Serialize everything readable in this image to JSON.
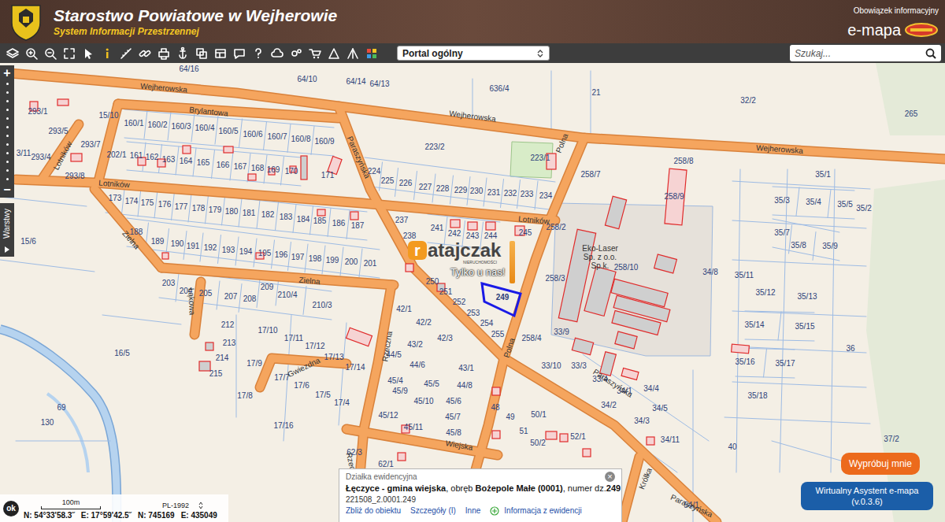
{
  "header": {
    "title": "Starostwo Powiatowe w Wejherowie",
    "subtitle": "System Informacji Przestrzennej",
    "info_link": "Obowiązek informacyjny",
    "brand": "e-mapa"
  },
  "toolbar": {
    "portal": {
      "value": "Portal ogólny"
    },
    "search": {
      "placeholder": "Szukaj..."
    }
  },
  "zoom_bar": {
    "zoom_in": "+",
    "zoom_out": "−"
  },
  "layers_tab": {
    "label": "Warstwy"
  },
  "map": {
    "streets": [
      "Wejherowska",
      "Wejherowska",
      "Wejherowska",
      "Brylantowa",
      "Paraszyńska",
      "Paraszyńska",
      "Paraszyńska",
      "Lotników",
      "Lotników",
      "Lotników",
      "Polna",
      "Polna",
      "Zielna",
      "Zielna",
      "Łąkowa",
      "Rzeczna",
      "Rzeczna",
      "Gwiezdna",
      "Wiejska",
      "Królka"
    ],
    "parcels": [
      {
        "label": "64/16",
        "selected": false
      },
      {
        "label": "64/10",
        "selected": false
      },
      {
        "label": "64/14",
        "selected": false
      },
      {
        "label": "64/13",
        "selected": false
      },
      {
        "label": "636/4",
        "selected": false
      },
      {
        "label": "21",
        "selected": false
      },
      {
        "label": "32/2",
        "selected": false
      },
      {
        "label": "265",
        "selected": false
      },
      {
        "label": "293/1",
        "selected": false
      },
      {
        "label": "15/10",
        "selected": false
      },
      {
        "label": "160/1",
        "selected": false
      },
      {
        "label": "160/2",
        "selected": false
      },
      {
        "label": "160/3",
        "selected": false
      },
      {
        "label": "160/4",
        "selected": false
      },
      {
        "label": "160/5",
        "selected": false
      },
      {
        "label": "160/6",
        "selected": false
      },
      {
        "label": "160/7",
        "selected": false
      },
      {
        "label": "160/8",
        "selected": false
      },
      {
        "label": "160/9",
        "selected": false
      },
      {
        "label": "293/5",
        "selected": false
      },
      {
        "label": "293/7",
        "selected": false
      },
      {
        "label": "3/11",
        "selected": false
      },
      {
        "label": "293/4",
        "selected": false
      },
      {
        "label": "202/1",
        "selected": false
      },
      {
        "label": "161",
        "selected": false
      },
      {
        "label": "162",
        "selected": false
      },
      {
        "label": "163",
        "selected": false
      },
      {
        "label": "164",
        "selected": false
      },
      {
        "label": "165",
        "selected": false
      },
      {
        "label": "166",
        "selected": false
      },
      {
        "label": "167",
        "selected": false
      },
      {
        "label": "168",
        "selected": false
      },
      {
        "label": "169",
        "selected": false
      },
      {
        "label": "170",
        "selected": false
      },
      {
        "label": "171",
        "selected": false
      },
      {
        "label": "293/8",
        "selected": false
      },
      {
        "label": "223/2",
        "selected": false
      },
      {
        "label": "223/1",
        "selected": false
      },
      {
        "label": "258/7",
        "selected": false
      },
      {
        "label": "258/8",
        "selected": false
      },
      {
        "label": "258/9",
        "selected": false
      },
      {
        "label": "224",
        "selected": false
      },
      {
        "label": "225",
        "selected": false
      },
      {
        "label": "226",
        "selected": false
      },
      {
        "label": "227",
        "selected": false
      },
      {
        "label": "228",
        "selected": false
      },
      {
        "label": "229",
        "selected": false
      },
      {
        "label": "230",
        "selected": false
      },
      {
        "label": "231",
        "selected": false
      },
      {
        "label": "232",
        "selected": false
      },
      {
        "label": "233",
        "selected": false
      },
      {
        "label": "234",
        "selected": false
      },
      {
        "label": "35/1",
        "selected": false
      },
      {
        "label": "173",
        "selected": false
      },
      {
        "label": "174",
        "selected": false
      },
      {
        "label": "175",
        "selected": false
      },
      {
        "label": "176",
        "selected": false
      },
      {
        "label": "177",
        "selected": false
      },
      {
        "label": "178",
        "selected": false
      },
      {
        "label": "179",
        "selected": false
      },
      {
        "label": "180",
        "selected": false
      },
      {
        "label": "181",
        "selected": false
      },
      {
        "label": "182",
        "selected": false
      },
      {
        "label": "183",
        "selected": false
      },
      {
        "label": "184",
        "selected": false
      },
      {
        "label": "185",
        "selected": false
      },
      {
        "label": "186",
        "selected": false
      },
      {
        "label": "187",
        "selected": false
      },
      {
        "label": "35/3",
        "selected": false
      },
      {
        "label": "35/4",
        "selected": false
      },
      {
        "label": "35/5",
        "selected": false
      },
      {
        "label": "35/2",
        "selected": false
      },
      {
        "label": "237",
        "selected": false
      },
      {
        "label": "241",
        "selected": false
      },
      {
        "label": "242",
        "selected": false
      },
      {
        "label": "243",
        "selected": false
      },
      {
        "label": "244",
        "selected": false
      },
      {
        "label": "245",
        "selected": false
      },
      {
        "label": "238",
        "selected": false
      },
      {
        "label": "188",
        "selected": false
      },
      {
        "label": "189",
        "selected": false
      },
      {
        "label": "190",
        "selected": false
      },
      {
        "label": "191",
        "selected": false
      },
      {
        "label": "192",
        "selected": false
      },
      {
        "label": "193",
        "selected": false
      },
      {
        "label": "194",
        "selected": false
      },
      {
        "label": "195",
        "selected": false
      },
      {
        "label": "196",
        "selected": false
      },
      {
        "label": "197",
        "selected": false
      },
      {
        "label": "198",
        "selected": false
      },
      {
        "label": "199",
        "selected": false
      },
      {
        "label": "200",
        "selected": false
      },
      {
        "label": "201",
        "selected": false
      },
      {
        "label": "15/6",
        "selected": false
      },
      {
        "label": "258/2",
        "selected": false
      },
      {
        "label": "35/7",
        "selected": false
      },
      {
        "label": "35/8",
        "selected": false
      },
      {
        "label": "35/9",
        "selected": false
      },
      {
        "label": "34/8",
        "selected": false
      },
      {
        "label": "35/11",
        "selected": false
      },
      {
        "label": "35/12",
        "selected": false
      },
      {
        "label": "35/13",
        "selected": false
      },
      {
        "label": "258/10",
        "selected": false
      },
      {
        "label": "258/3",
        "selected": false
      },
      {
        "label": "203",
        "selected": false
      },
      {
        "label": "204",
        "selected": false
      },
      {
        "label": "205",
        "selected": false
      },
      {
        "label": "207",
        "selected": false
      },
      {
        "label": "208",
        "selected": false
      },
      {
        "label": "209",
        "selected": false
      },
      {
        "label": "210/4",
        "selected": false
      },
      {
        "label": "210/3",
        "selected": false
      },
      {
        "label": "250",
        "selected": false
      },
      {
        "label": "251",
        "selected": false
      },
      {
        "label": "252",
        "selected": false
      },
      {
        "label": "253",
        "selected": false
      },
      {
        "label": "254",
        "selected": false
      },
      {
        "label": "255",
        "selected": false
      },
      {
        "label": "249",
        "selected": true
      },
      {
        "label": "42/1",
        "selected": false
      },
      {
        "label": "42/2",
        "selected": false
      },
      {
        "label": "42/3",
        "selected": false
      },
      {
        "label": "258/4",
        "selected": false
      },
      {
        "label": "33/9",
        "selected": false
      },
      {
        "label": "35/14",
        "selected": false
      },
      {
        "label": "35/15",
        "selected": false
      },
      {
        "label": "36",
        "selected": false
      },
      {
        "label": "17/10",
        "selected": false
      },
      {
        "label": "212",
        "selected": false
      },
      {
        "label": "17/11",
        "selected": false
      },
      {
        "label": "17/12",
        "selected": false
      },
      {
        "label": "17/13",
        "selected": false
      },
      {
        "label": "16/5",
        "selected": false
      },
      {
        "label": "213",
        "selected": false
      },
      {
        "label": "214",
        "selected": false
      },
      {
        "label": "215",
        "selected": false
      },
      {
        "label": "43/2",
        "selected": false
      },
      {
        "label": "44/5",
        "selected": false
      },
      {
        "label": "43/1",
        "selected": false
      },
      {
        "label": "44/6",
        "selected": false
      },
      {
        "label": "44/8",
        "selected": false
      },
      {
        "label": "33/10",
        "selected": false
      },
      {
        "label": "33/3",
        "selected": false
      },
      {
        "label": "33/4",
        "selected": false
      },
      {
        "label": "35/16",
        "selected": false
      },
      {
        "label": "35/17",
        "selected": false
      },
      {
        "label": "17/9",
        "selected": false
      },
      {
        "label": "17/7",
        "selected": false
      },
      {
        "label": "17/6",
        "selected": false
      },
      {
        "label": "17/14",
        "selected": false
      },
      {
        "label": "45/4",
        "selected": false
      },
      {
        "label": "45/5",
        "selected": false
      },
      {
        "label": "45/9",
        "selected": false
      },
      {
        "label": "34/1",
        "selected": false
      },
      {
        "label": "34/4",
        "selected": false
      },
      {
        "label": "35/18",
        "selected": false
      },
      {
        "label": "17/8",
        "selected": false
      },
      {
        "label": "17/5",
        "selected": false
      },
      {
        "label": "17/4",
        "selected": false
      },
      {
        "label": "45/10",
        "selected": false
      },
      {
        "label": "45/6",
        "selected": false
      },
      {
        "label": "48",
        "selected": false
      },
      {
        "label": "34/2",
        "selected": false
      },
      {
        "label": "34/5",
        "selected": false
      },
      {
        "label": "34/3",
        "selected": false
      },
      {
        "label": "45/12",
        "selected": false
      },
      {
        "label": "45/7",
        "selected": false
      },
      {
        "label": "49",
        "selected": false
      },
      {
        "label": "50/1",
        "selected": false
      },
      {
        "label": "69",
        "selected": false
      },
      {
        "label": "130",
        "selected": false
      },
      {
        "label": "17/16",
        "selected": false
      },
      {
        "label": "45/8",
        "selected": false
      },
      {
        "label": "45/11",
        "selected": false
      },
      {
        "label": "51",
        "selected": false
      },
      {
        "label": "52/1",
        "selected": false
      },
      {
        "label": "50/2",
        "selected": false
      },
      {
        "label": "34/11",
        "selected": false
      },
      {
        "label": "40",
        "selected": false
      },
      {
        "label": "37/2",
        "selected": false
      },
      {
        "label": "62/3",
        "selected": false
      },
      {
        "label": "62/1",
        "selected": false
      },
      {
        "label": "54/1",
        "selected": false
      }
    ],
    "company": [
      "Eko-Laser",
      "Sp. z o.o.",
      "Sp.k."
    ]
  },
  "watermark": {
    "mark": "r",
    "word": "atajczak",
    "tagline": "NIERUCHOMOŚCI",
    "slogan": "Tylko u nas!"
  },
  "popup": {
    "title": "Działka ewidencyjna",
    "close": "×",
    "description": [
      {
        "text": "Łęczyce - gmina wiejska",
        "bold": true
      },
      {
        "text": ", obręb ",
        "bold": false
      },
      {
        "text": "Bożepole Małe (0001)",
        "bold": true
      },
      {
        "text": ", numer dz.",
        "bold": false
      },
      {
        "text": "249",
        "bold": true
      }
    ],
    "id": "221508_2.0001.249",
    "links": [
      "Zbliż do obiektu",
      "Szczegóły (I)",
      "Inne",
      "Informacja z ewidencji"
    ]
  },
  "scale_bar": {
    "ok": "ok",
    "distance": "100m",
    "crs": "PL-1992",
    "coords": [
      "N: 54°33'58.3˝",
      "E: 17°59'42.5˝",
      "N: 745169",
      "E: 435049"
    ]
  },
  "assistant": {
    "try": "Wypróbuj mnie",
    "title": "Wirtualny Asystent e-mapa",
    "version": "(v.0.3.6)"
  }
}
